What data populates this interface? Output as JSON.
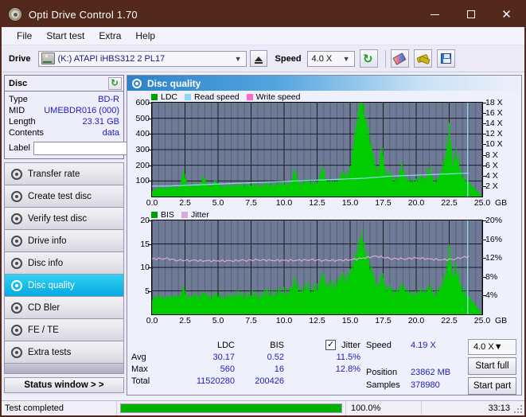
{
  "window": {
    "title": "Opti Drive Control 1.70",
    "icon": "disc-icon",
    "minimize": "—",
    "maximize": "□",
    "close": "✕"
  },
  "menu": {
    "items": [
      "File",
      "Start test",
      "Extra",
      "Help"
    ]
  },
  "toolbar": {
    "drive_label": "Drive",
    "drive_value": "(K:)  ATAPI iHBS312  2 PL17",
    "eject_title": "Eject",
    "speed_label": "Speed",
    "speed_value": "4.0 X",
    "buttons": [
      "refresh-icon",
      "eraser-icon",
      "tools-icon",
      "save-icon"
    ]
  },
  "disc": {
    "title": "Disc",
    "rows": [
      {
        "key": "Type",
        "value": "BD-R"
      },
      {
        "key": "MID",
        "value": "UMEBDR016 (000)"
      },
      {
        "key": "Length",
        "value": "23.31 GB"
      },
      {
        "key": "Contents",
        "value": "data"
      }
    ],
    "label_key": "Label",
    "label_value": ""
  },
  "sidebar": {
    "items": [
      {
        "label": "Transfer rate",
        "active": false
      },
      {
        "label": "Create test disc",
        "active": false
      },
      {
        "label": "Verify test disc",
        "active": false
      },
      {
        "label": "Drive info",
        "active": false
      },
      {
        "label": "Disc info",
        "active": false
      },
      {
        "label": "Disc quality",
        "active": true
      },
      {
        "label": "CD Bler",
        "active": false
      },
      {
        "label": "FE / TE",
        "active": false
      },
      {
        "label": "Extra tests",
        "active": false
      }
    ],
    "status_window": "Status window > >"
  },
  "panel": {
    "title": "Disc quality"
  },
  "chart_data": [
    {
      "type": "area",
      "title": "Disc quality - LDC",
      "xlabel": "GB",
      "ylabel": "",
      "xlim": [
        0,
        25
      ],
      "ylim": [
        0,
        600
      ],
      "xticks": [
        "0.0",
        "2.5",
        "5.0",
        "7.5",
        "10.0",
        "12.5",
        "15.0",
        "17.5",
        "20.0",
        "22.5",
        "25.0"
      ],
      "xunit": "GB",
      "yticks": [
        100,
        200,
        300,
        400,
        500,
        600
      ],
      "y2ticks": [
        "2 X",
        "4 X",
        "6 X",
        "8 X",
        "10 X",
        "12 X",
        "14 X",
        "16 X",
        "18 X"
      ],
      "y2lim": [
        0,
        18
      ],
      "grid": true,
      "legend": [
        {
          "name": "LDC",
          "color": "#00cc00"
        },
        {
          "name": "Read speed",
          "color": "#8fd6f5"
        },
        {
          "name": "Write speed",
          "color": "#ff66cc"
        }
      ],
      "series": [
        {
          "name": "LDC",
          "color": "#00cc00",
          "x": [
            0.0,
            0.3,
            0.6,
            0.9,
            1.2,
            1.5,
            1.8,
            2.1,
            2.4,
            2.7,
            3.0,
            3.3,
            3.6,
            3.9,
            4.2,
            4.5,
            4.8,
            5.1,
            5.4,
            5.7,
            6.0,
            6.3,
            6.6,
            6.9,
            7.2,
            7.5,
            7.8,
            8.1,
            8.4,
            8.7,
            9.0,
            9.3,
            9.6,
            9.9,
            10.2,
            10.5,
            10.8,
            11.1,
            11.4,
            11.7,
            12.0,
            12.3,
            12.6,
            12.9,
            13.2,
            13.5,
            13.8,
            14.1,
            14.4,
            14.7,
            15.0,
            15.3,
            15.6,
            15.9,
            16.2,
            16.5,
            16.8,
            17.1,
            17.4,
            17.7,
            18.0,
            18.3,
            18.6,
            18.9,
            19.2,
            19.5,
            19.8,
            20.1,
            20.4,
            20.7,
            21.0,
            21.3,
            21.6,
            21.9,
            22.2,
            22.5,
            22.8,
            23.1,
            23.4,
            23.7,
            24.0
          ],
          "values": [
            35,
            40,
            55,
            45,
            50,
            60,
            48,
            55,
            150,
            60,
            62,
            70,
            58,
            120,
            66,
            60,
            95,
            62,
            58,
            64,
            60,
            66,
            70,
            62,
            64,
            70,
            66,
            60,
            68,
            72,
            70,
            66,
            74,
            78,
            70,
            76,
            160,
            80,
            74,
            96,
            78,
            82,
            84,
            180,
            88,
            92,
            86,
            90,
            140,
            120,
            150,
            330,
            480,
            560,
            430,
            330,
            210,
            130,
            300,
            120,
            140,
            96,
            100,
            180,
            110,
            90,
            86,
            100,
            120,
            92,
            180,
            88,
            96,
            150,
            230,
            380,
            200,
            260,
            130,
            100,
            90
          ]
        },
        {
          "name": "Read speed",
          "color": "#8fd6f5",
          "x": [
            0.0,
            1.0,
            2.0,
            3.0,
            4.0,
            5.0,
            6.0,
            7.0,
            8.0,
            9.0,
            10.0,
            11.0,
            12.0,
            13.0,
            14.0,
            15.0,
            16.0,
            17.0,
            18.0,
            19.0,
            20.0,
            21.0,
            22.0,
            23.0,
            24.0
          ],
          "values": [
            2.0,
            2.0,
            2.1,
            2.2,
            2.3,
            2.4,
            2.5,
            2.6,
            2.7,
            2.8,
            2.9,
            3.0,
            3.1,
            3.2,
            3.3,
            3.4,
            3.5,
            3.7,
            3.9,
            4.0,
            4.1,
            4.2,
            4.3,
            4.4,
            4.5
          ],
          "unit": "X"
        }
      ]
    },
    {
      "type": "area",
      "title": "Disc quality - BIS / Jitter",
      "xlabel": "GB",
      "xlim": [
        0,
        25
      ],
      "ylim": [
        0,
        20
      ],
      "xticks": [
        "0.0",
        "2.5",
        "5.0",
        "7.5",
        "10.0",
        "12.5",
        "15.0",
        "17.5",
        "20.0",
        "22.5",
        "25.0"
      ],
      "xunit": "GB",
      "yticks": [
        5,
        10,
        15,
        20
      ],
      "y2ticks": [
        "4%",
        "8%",
        "12%",
        "16%",
        "20%"
      ],
      "y2lim": [
        0,
        20
      ],
      "grid": true,
      "legend": [
        {
          "name": "BIS",
          "color": "#00cc00"
        },
        {
          "name": "Jitter",
          "color": "#d9a8d9"
        }
      ],
      "series": [
        {
          "name": "BIS",
          "color": "#00cc00",
          "x": [
            0.0,
            0.3,
            0.6,
            0.9,
            1.2,
            1.5,
            1.8,
            2.1,
            2.4,
            2.7,
            3.0,
            3.3,
            3.6,
            3.9,
            4.2,
            4.5,
            4.8,
            5.1,
            5.4,
            5.7,
            6.0,
            6.3,
            6.6,
            6.9,
            7.2,
            7.5,
            7.8,
            8.1,
            8.4,
            8.7,
            9.0,
            9.3,
            9.6,
            9.9,
            10.2,
            10.5,
            10.8,
            11.1,
            11.4,
            11.7,
            12.0,
            12.3,
            12.6,
            12.9,
            13.2,
            13.5,
            13.8,
            14.1,
            14.4,
            14.7,
            15.0,
            15.3,
            15.6,
            15.9,
            16.2,
            16.5,
            16.8,
            17.1,
            17.4,
            17.7,
            18.0,
            18.3,
            18.6,
            18.9,
            19.2,
            19.5,
            19.8,
            20.1,
            20.4,
            20.7,
            21.0,
            21.3,
            21.6,
            21.9,
            22.2,
            22.5,
            22.8,
            23.1,
            23.4,
            23.7,
            24.0
          ],
          "values": [
            3.0,
            3.2,
            3.5,
            3.0,
            3.4,
            3.2,
            3.6,
            3.3,
            5.0,
            3.2,
            3.4,
            3.8,
            3.2,
            4.2,
            3.5,
            3.3,
            4.0,
            3.4,
            3.2,
            3.6,
            3.4,
            3.8,
            4.0,
            3.5,
            3.6,
            4.0,
            3.8,
            3.4,
            4.0,
            4.2,
            4.0,
            3.8,
            4.4,
            4.6,
            4.2,
            4.5,
            7.0,
            4.8,
            4.4,
            6.0,
            4.6,
            5.0,
            5.2,
            8.0,
            5.4,
            6.0,
            5.6,
            6.2,
            7.5,
            6.8,
            7.8,
            10.0,
            13.0,
            14.5,
            11.5,
            9.5,
            7.0,
            5.0,
            8.0,
            4.8,
            5.2,
            4.2,
            4.4,
            5.6,
            4.6,
            4.0,
            3.8,
            4.2,
            4.6,
            4.0,
            5.8,
            3.8,
            4.2,
            5.6,
            7.5,
            11.8,
            8.0,
            9.0,
            5.0,
            4.2,
            3.8
          ]
        },
        {
          "name": "Jitter",
          "color": "#d9a8d9",
          "x": [
            0.0,
            1.0,
            2.0,
            3.0,
            4.0,
            5.0,
            6.0,
            7.0,
            8.0,
            9.0,
            10.0,
            11.0,
            12.0,
            13.0,
            14.0,
            15.0,
            16.0,
            17.0,
            18.0,
            19.0,
            20.0,
            21.0,
            22.0,
            23.0,
            24.0
          ],
          "values": [
            11.8,
            11.9,
            11.5,
            11.5,
            11.4,
            11.4,
            11.4,
            11.5,
            11.6,
            11.5,
            11.5,
            11.5,
            11.6,
            11.5,
            11.5,
            11.6,
            12.0,
            12.4,
            11.9,
            11.8,
            12.0,
            11.8,
            11.6,
            11.8,
            12.4
          ],
          "unit": "%"
        }
      ]
    }
  ],
  "stats": {
    "headers": {
      "row": "",
      "ldc": "LDC",
      "bis": "BIS",
      "jitter": "Jitter"
    },
    "jitter_checked": true,
    "rows": [
      {
        "label": "Avg",
        "ldc": "30.17",
        "bis": "0.52",
        "jitter": "11.5%"
      },
      {
        "label": "Max",
        "ldc": "560",
        "bis": "16",
        "jitter": "12.8%"
      },
      {
        "label": "Total",
        "ldc": "11520280",
        "bis": "200426",
        "jitter": ""
      }
    ]
  },
  "results": {
    "speed_key": "Speed",
    "speed_value": "4.19 X",
    "position_key": "Position",
    "position_value": "23862 MB",
    "samples_key": "Samples",
    "samples_value": "378980",
    "speed_select": "4.0 X",
    "start_full": "Start full",
    "start_part": "Start part"
  },
  "statusbar": {
    "message": "Test completed",
    "progress_percent": 100.0,
    "percent_text": "100.0%",
    "elapsed": "33:13"
  },
  "colors": {
    "titlebar": "#53291b",
    "accent": "#2020c0",
    "plot_bg": "#6e7a96",
    "green": "#00cc00",
    "cyan": "#8fd6f5",
    "pink": "#d9a8d9",
    "magenta": "#ff66cc",
    "selected": "#07a8e0"
  }
}
